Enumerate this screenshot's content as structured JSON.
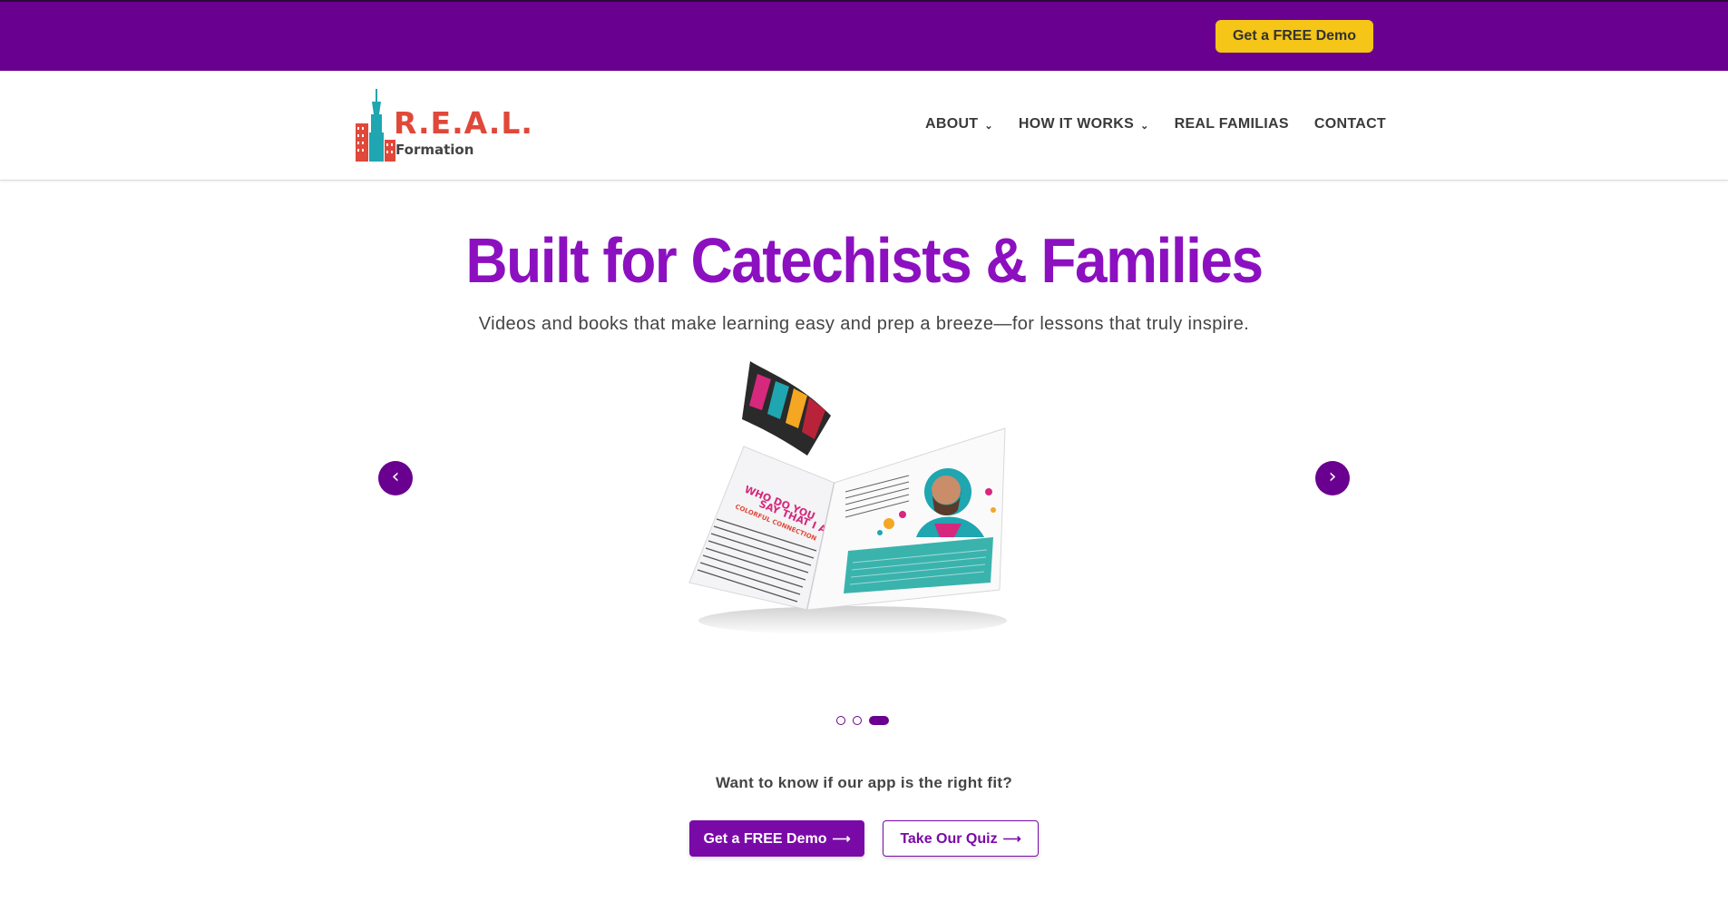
{
  "topbar": {
    "demo_label": "Get a FREE Demo",
    "bg_color": "#6a008f",
    "button_color": "#f5c518"
  },
  "header": {
    "logo": {
      "word": "R.E.A.L.",
      "sub": "Formation"
    },
    "nav": [
      {
        "label": "ABOUT",
        "has_dropdown": true
      },
      {
        "label": "HOW IT WORKS",
        "has_dropdown": true
      },
      {
        "label": "REAL FAMILIAS",
        "has_dropdown": false
      },
      {
        "label": "CONTACT",
        "has_dropdown": false
      }
    ]
  },
  "hero": {
    "title": "Built for Catechists & Families",
    "subtitle": "Videos and books that make learning easy and prep a breeze—for lessons that truly inspire.",
    "title_color": "#8c10c0"
  },
  "carousel": {
    "prev_icon": "‹",
    "next_icon": "›",
    "book": {
      "heading_line1": "WHO DO YOU",
      "heading_line2": "SAY THAT I AM?",
      "label": "COLORFUL CONNECTION"
    },
    "slide_count": 3,
    "active_index": 2
  },
  "cta": {
    "question": "Want to know if our app is the right fit?",
    "primary_label": "Get a FREE Demo",
    "secondary_label": "Take Our Quiz",
    "arrow_icon": "⟶",
    "brand_color": "#7a0aa8"
  }
}
